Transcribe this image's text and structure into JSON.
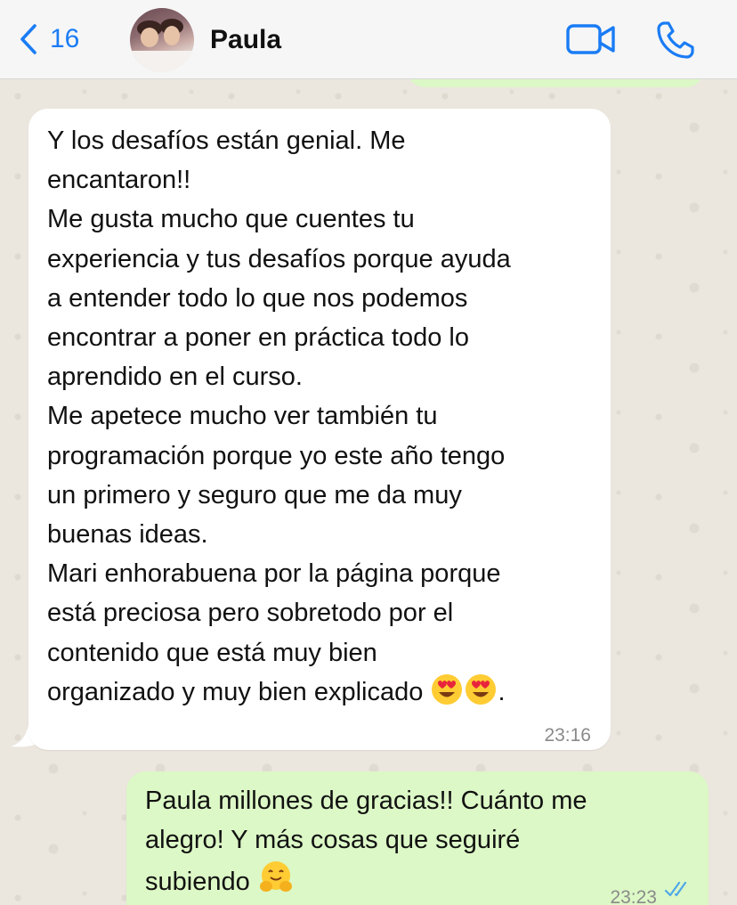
{
  "header": {
    "back_count": "16",
    "contact_name": "Paula",
    "accent_color": "#1a7cf5",
    "icons": [
      "chevron-left-icon",
      "video-call-icon",
      "phone-icon"
    ]
  },
  "messages": [
    {
      "direction": "incoming",
      "lines": [
        "Y los desafíos están genial. Me",
        "encantaron!!",
        "Me gusta mucho que cuentes tu",
        "experiencia y tus desafíos porque ayuda",
        "a entender todo lo que nos podemos",
        "encontrar a poner en práctica todo lo",
        "aprendido en el curso.",
        "Me apetece mucho ver también tu",
        "programación porque yo este año tengo",
        "un primero y seguro que me da muy",
        "buenas ideas.",
        "Mari enhorabuena por la página porque",
        "está preciosa pero sobretodo por el",
        "contenido que está muy bien",
        "organizado y muy bien explicado"
      ],
      "trailing_emojis": [
        "heart-eyes-emoji",
        "heart-eyes-emoji"
      ],
      "trailing_text": ".",
      "time": "23:16",
      "bubble_color": "#ffffff"
    },
    {
      "direction": "outgoing",
      "lines": [
        "Paula millones de gracias!! Cuánto me",
        "alegro! Y más cosas que seguiré",
        "subiendo"
      ],
      "trailing_emojis": [
        "hugging-face-emoji"
      ],
      "time": "23:23",
      "status": "read",
      "bubble_color": "#dcf8c6"
    }
  ]
}
